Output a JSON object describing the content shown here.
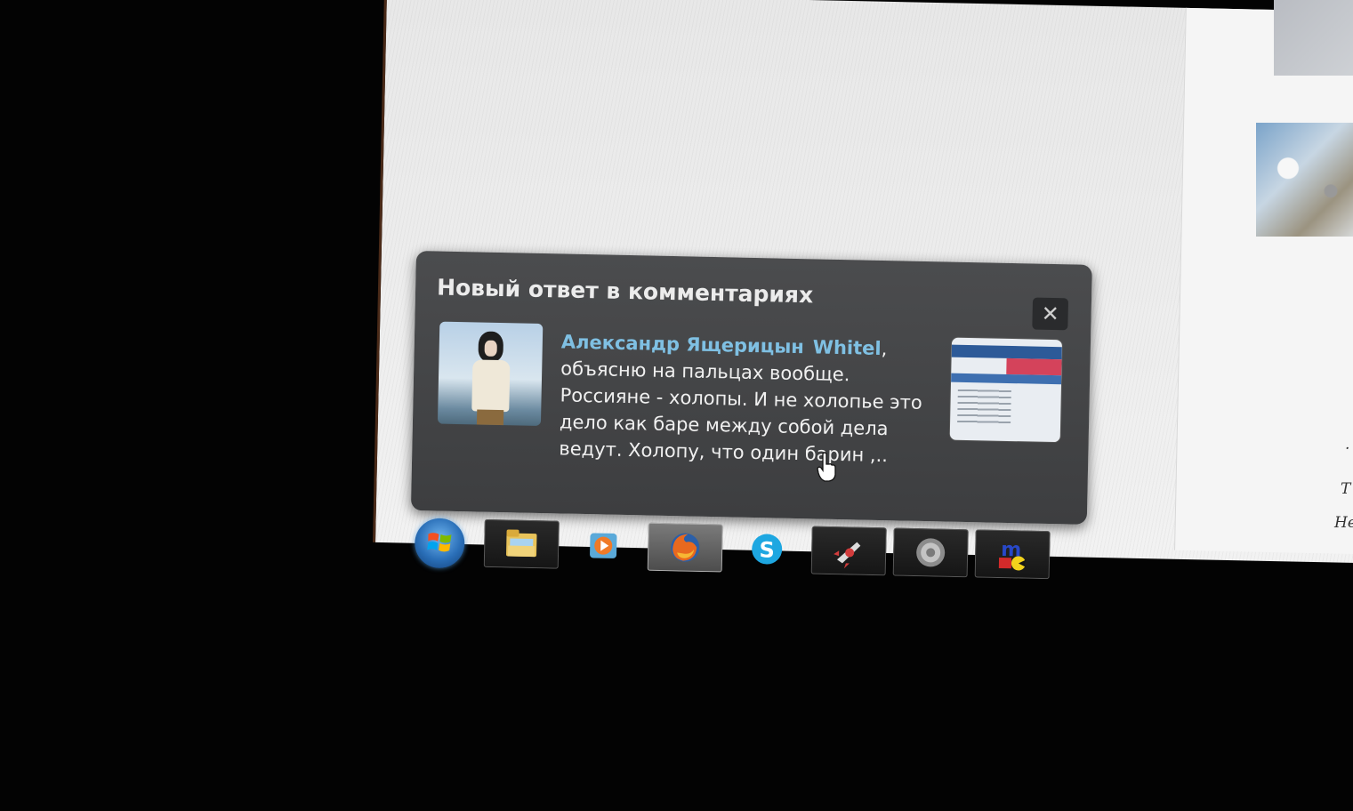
{
  "notification": {
    "title": "Новый ответ в комментариях",
    "close_label": "✕",
    "author": "Александр Ящерицын",
    "reply_to": "Whitel",
    "reply_to_suffix": ",",
    "comment_text": "объясню на пальцах вообще. Россияне - холопы. И не холопье это дело как баре между собой дела ведут. Холопу, что один барин ,.."
  },
  "page_side": {
    "text_line_1": "Т",
    "text_line_2": "Не",
    "text_dot": "."
  },
  "taskbar": {
    "items": [
      {
        "name": "start",
        "icon": "windows-logo-icon"
      },
      {
        "name": "explorer",
        "icon": "folder-icon"
      },
      {
        "name": "media-player",
        "icon": "media-player-icon"
      },
      {
        "name": "firefox",
        "icon": "firefox-icon",
        "active": true
      },
      {
        "name": "skype",
        "icon": "skype-icon"
      },
      {
        "name": "app-rocket",
        "icon": "rocket-icon"
      },
      {
        "name": "speaker",
        "icon": "speaker-icon"
      },
      {
        "name": "mirc",
        "icon": "mirc-icon"
      }
    ]
  },
  "colors": {
    "popup_bg": "#434446",
    "author_link": "#7fc0e3",
    "comment_text": "#f0f0f0"
  }
}
